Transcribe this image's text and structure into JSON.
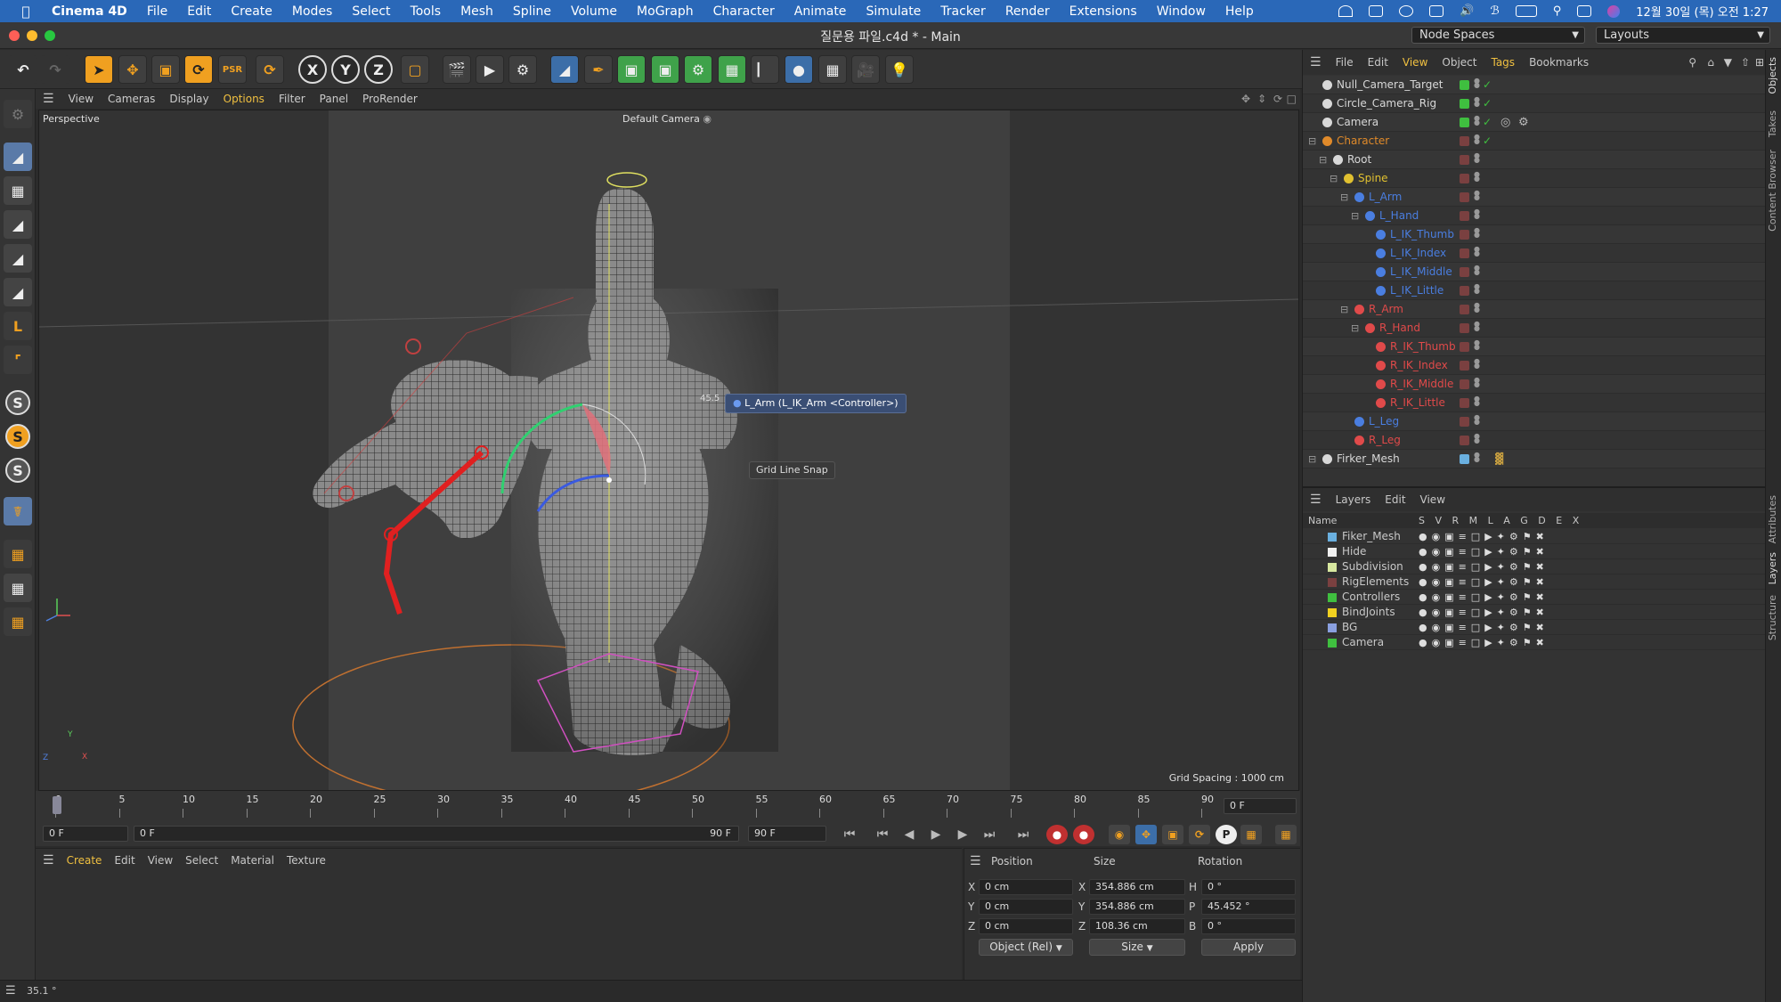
{
  "menubar": {
    "app_name": "Cinema 4D",
    "items": [
      "File",
      "Edit",
      "Create",
      "Modes",
      "Select",
      "Tools",
      "Mesh",
      "Spline",
      "Volume",
      "MoGraph",
      "Character",
      "Animate",
      "Simulate",
      "Tracker",
      "Render",
      "Extensions",
      "Window",
      "Help"
    ],
    "clock": "12월 30일 (목) 오전 1:27"
  },
  "window": {
    "title": "질문용 파일.c4d * - Main",
    "node_spaces": "Node Spaces",
    "layouts": "Layouts"
  },
  "viewport_menu": {
    "items": [
      "View",
      "Cameras",
      "Display",
      "Options",
      "Filter",
      "Panel",
      "ProRender"
    ],
    "active": "Options"
  },
  "viewport": {
    "label": "Perspective",
    "camera": "Default Camera",
    "tooltip": "L_Arm (L_IK_Arm <Controller>)",
    "snap_label": "Grid Line Snap",
    "angle_label": "45.5",
    "grid_spacing": "Grid Spacing : 1000 cm",
    "axis_y": "Y",
    "axis_z": "Z",
    "axis_x": "X"
  },
  "timeline": {
    "ticks": [
      "0",
      "5",
      "10",
      "15",
      "20",
      "25",
      "30",
      "35",
      "40",
      "45",
      "50",
      "55",
      "60",
      "65",
      "70",
      "75",
      "80",
      "85",
      "90"
    ],
    "current_frame": "0 F",
    "start_field": "0 F",
    "min_field": "0 F",
    "range_end": "90 F",
    "end_field": "90 F"
  },
  "material_menu": {
    "items": [
      "Create",
      "Edit",
      "View",
      "Select",
      "Material",
      "Texture"
    ]
  },
  "coordinates": {
    "headers": {
      "position": "Position",
      "size": "Size",
      "rotation": "Rotation"
    },
    "rows": [
      {
        "axis": "X",
        "pos": "0 cm",
        "size_axis": "X",
        "size": "354.886 cm",
        "rot_axis": "H",
        "rot": "0 °"
      },
      {
        "axis": "Y",
        "pos": "0 cm",
        "size_axis": "Y",
        "size": "354.886 cm",
        "rot_axis": "P",
        "rot": "45.452 °"
      },
      {
        "axis": "Z",
        "pos": "0 cm",
        "size_axis": "Z",
        "size": "108.36 cm",
        "rot_axis": "B",
        "rot": "0 °"
      }
    ],
    "mode": "Object (Rel)",
    "size_mode": "Size",
    "apply": "Apply"
  },
  "status_text": "35.1 °",
  "objects_menu": {
    "items": [
      "File",
      "Edit",
      "View",
      "Object",
      "Tags",
      "Bookmarks"
    ]
  },
  "objects": [
    {
      "name": "Null_Camera_Target",
      "color": "#d8d8d8",
      "check": "#3fbf3f",
      "icon": "null-icon"
    },
    {
      "name": "Circle_Camera_Rig",
      "color": "#d8d8d8",
      "check": "#3fbf3f",
      "icon": "circle-icon"
    },
    {
      "name": "Camera",
      "color": "#d8d8d8",
      "check": "#3fbf3f",
      "icon": "camera-icon"
    },
    {
      "name": "Character",
      "color": "#e08a2a",
      "check": "#7a4040",
      "icon": "character-icon"
    },
    {
      "name": "Root",
      "color": "#d8d8d8",
      "check": "#7a4040",
      "icon": "joint-icon"
    },
    {
      "name": "Spine",
      "color": "#e0c030",
      "check": "#7a4040",
      "icon": "joint-icon"
    },
    {
      "name": "L_Arm",
      "color": "#4a7ee0",
      "check": "#7a4040",
      "icon": "joint-icon"
    },
    {
      "name": "L_Hand",
      "color": "#4a7ee0",
      "check": "#7a4040",
      "icon": "joint-icon"
    },
    {
      "name": "L_IK_Thumb",
      "color": "#4a7ee0",
      "check": "#7a4040",
      "icon": "joint-icon"
    },
    {
      "name": "L_IK_Index",
      "color": "#4a7ee0",
      "check": "#7a4040",
      "icon": "joint-icon"
    },
    {
      "name": "L_IK_Middle",
      "color": "#4a7ee0",
      "check": "#7a4040",
      "icon": "joint-icon"
    },
    {
      "name": "L_IK_Little",
      "color": "#4a7ee0",
      "check": "#7a4040",
      "icon": "joint-icon"
    },
    {
      "name": "R_Arm",
      "color": "#e04a4a",
      "check": "#7a4040",
      "icon": "joint-icon"
    },
    {
      "name": "R_Hand",
      "color": "#e04a4a",
      "check": "#7a4040",
      "icon": "joint-icon"
    },
    {
      "name": "R_IK_Thumb",
      "color": "#e04a4a",
      "check": "#7a4040",
      "icon": "joint-icon"
    },
    {
      "name": "R_IK_Index",
      "color": "#e04a4a",
      "check": "#7a4040",
      "icon": "joint-icon"
    },
    {
      "name": "R_IK_Middle",
      "color": "#e04a4a",
      "check": "#7a4040",
      "icon": "joint-icon"
    },
    {
      "name": "R_IK_Little",
      "color": "#e04a4a",
      "check": "#7a4040",
      "icon": "joint-icon"
    },
    {
      "name": "L_Leg",
      "color": "#4a7ee0",
      "check": "#7a4040",
      "icon": "joint-icon"
    },
    {
      "name": "R_Leg",
      "color": "#e04a4a",
      "check": "#7a4040",
      "icon": "joint-icon"
    },
    {
      "name": "Firker_Mesh",
      "color": "#d8d8d8",
      "check": "#6ab0e0",
      "icon": "mesh-icon"
    }
  ],
  "layers_menu": {
    "items": [
      "Layers",
      "Edit",
      "View"
    ]
  },
  "layers_header": {
    "name": "Name",
    "cols": "S V R M L A G D E X"
  },
  "layers": [
    {
      "name": "Fiker_Mesh",
      "color": "#6ab0e0"
    },
    {
      "name": "Hide",
      "color": "#f0f0f0"
    },
    {
      "name": "Subdivision",
      "color": "#d8e8a0"
    },
    {
      "name": "RigElements",
      "color": "#7a4040"
    },
    {
      "name": "Controllers",
      "color": "#3fbf3f"
    },
    {
      "name": "BindJoints",
      "color": "#f0d020"
    },
    {
      "name": "BG",
      "color": "#8aa0e0"
    },
    {
      "name": "Camera",
      "color": "#3fbf3f"
    }
  ],
  "side_tabs": [
    "Objects",
    "Takes",
    "Content Browser",
    "Attributes",
    "Layers",
    "Structure"
  ]
}
